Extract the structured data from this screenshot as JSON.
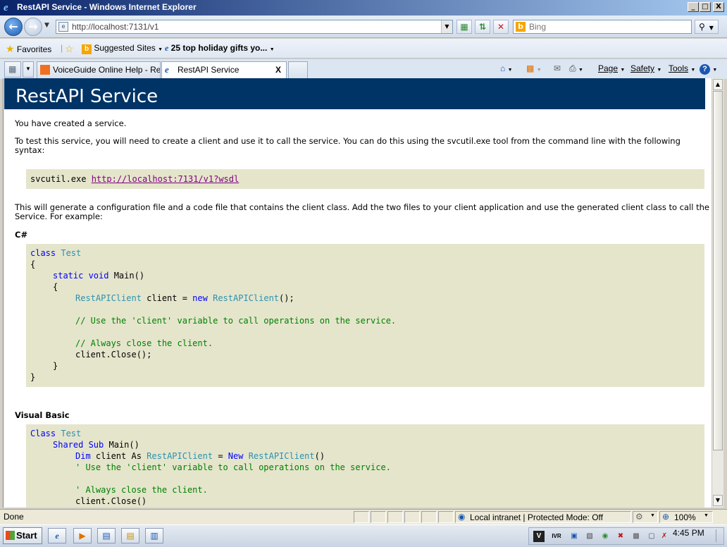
{
  "window": {
    "title": "RestAPI Service - Windows Internet Explorer",
    "minimize": "_",
    "maximize": "□",
    "close": "X"
  },
  "toolbar": {
    "address_url": "http://localhost:7131/v1",
    "search_placeholder": "Bing"
  },
  "favorites_bar": {
    "favorites_label": "Favorites",
    "suggested_sites_label": "Suggested Sites",
    "feed_label": "25 top holiday gifts yo..."
  },
  "tabs": [
    {
      "label": "VoiceGuide Online Help - Rep..."
    },
    {
      "label": "RestAPI Service",
      "close": "X"
    }
  ],
  "command_bar": {
    "page_label": "Page",
    "safety_label": "Safety",
    "tools_label": "Tools"
  },
  "page": {
    "heading": "RestAPI Service",
    "created_text": "You have created a service.",
    "intro_line1": "To test this service, you will need to create a client and use it to call the service. You can do this using the svcutil.exe tool from the command line with the following",
    "intro_line2": "syntax:",
    "svcutil_cmd": "svcutil.exe ",
    "wsdl_link": "http://localhost:7131/v1?wsdl",
    "generate_line1": "This will generate a configuration file and a code file that contains the client class. Add the two files to your client application and use the generated client class to call the",
    "generate_line2": "Service. For example:",
    "csharp_heading": "C#",
    "vb_heading": "Visual Basic",
    "csharp_code": {
      "l1_kw": "class",
      "l1_ty": "Test",
      "l2": "{",
      "l3_kw": "static void",
      "l3_rest": " Main()",
      "l4": "{",
      "l5_ty1": "RestAPIClient",
      "l5_mid": " client = ",
      "l5_kw": "new",
      "l5_ty2": "RestAPIClient",
      "l5_end": "();",
      "l6_cm": "// Use the 'client' variable to call operations on the service.",
      "l7_cm": "// Always close the client.",
      "l8": "client.Close();",
      "l9": "}",
      "l10": "}"
    },
    "vb_code": {
      "l1_kw": "Class",
      "l1_ty": "Test",
      "l2_kw": "Shared Sub",
      "l2_rest": " Main()",
      "l3_kw1": "Dim",
      "l3_mid1": " client As ",
      "l3_ty1": "RestAPIClient",
      "l3_mid2": " = ",
      "l3_kw2": "New",
      "l3_ty2": "RestAPIClient",
      "l3_end": "()",
      "l4_cm": "' Use the 'client' variable to call operations on the service.",
      "l5_cm": "' Always close the client.",
      "l6": "client.Close()"
    }
  },
  "status_bar": {
    "status_text": "Done",
    "zone_text": "Local intranet | Protected Mode: Off",
    "zoom_text": "100%"
  },
  "taskbar": {
    "start_label": "Start",
    "tray_ivr": "IVR",
    "clock": "4:45 PM"
  },
  "colors": {
    "page_header_bg": "#003366",
    "code_bg": "#e5e5cc",
    "keyword": "#0000ff",
    "type": "#2b91af",
    "comment": "#008000",
    "visited_link": "#800080"
  }
}
